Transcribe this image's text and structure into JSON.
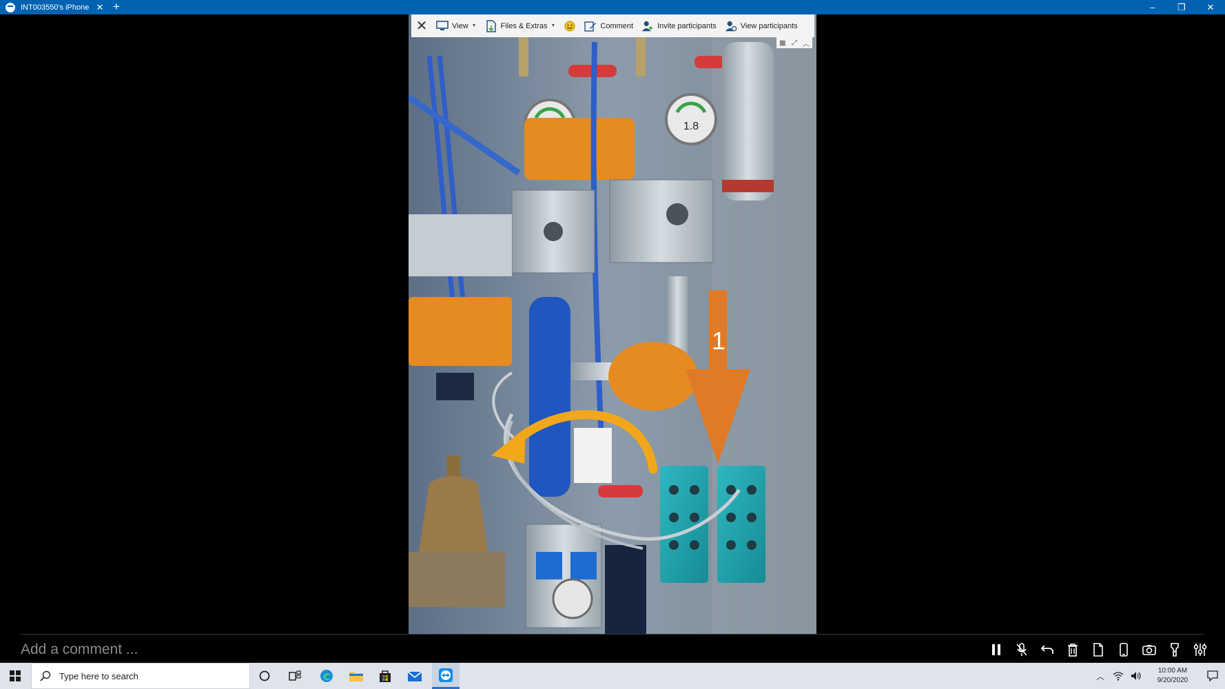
{
  "window": {
    "tab_title": "INT003550's iPhone",
    "new_tab": "+",
    "minimize": "–",
    "restore": "❐",
    "close": "✕"
  },
  "toolbar": {
    "close": "✕",
    "view": "View",
    "files_extras": "Files & Extras",
    "comment": "Comment",
    "invite_participants": "Invite participants",
    "view_participants": "View participants"
  },
  "annotation": {
    "number": "1"
  },
  "comment": {
    "placeholder": "Add a comment ..."
  },
  "taskbar": {
    "search_placeholder": "Type here to search",
    "time": "10:00 AM",
    "date": "9/20/2020"
  },
  "colors": {
    "titlebar": "#0062b1",
    "annotation_arrow": "#e07a26",
    "annotation_curve": "#f2a71b",
    "taskbar": "#dfe4ec"
  }
}
